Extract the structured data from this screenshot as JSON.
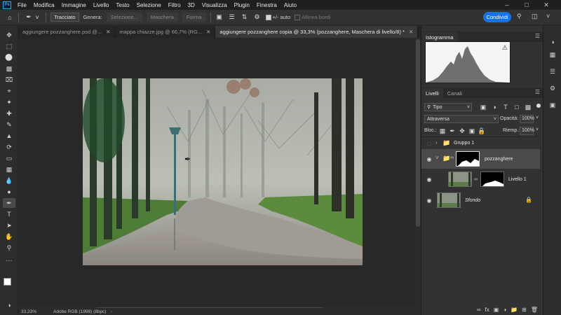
{
  "app": {
    "logo_text": "Ps"
  },
  "menu": [
    "File",
    "Modifica",
    "Immagine",
    "Livello",
    "Testo",
    "Selezione",
    "Filtro",
    "3D",
    "Visualizza",
    "Plugin",
    "Finestra",
    "Aiuto"
  ],
  "options": {
    "mode_value": "Tracciato",
    "generate_label": "Genera:",
    "selection_label": "Selezione...",
    "mask_label": "Maschera",
    "shape_label": "Forma",
    "auto_label": "+/- auto",
    "align_edges_label": "Allinea bordi",
    "share_label": "Condividi"
  },
  "tabs": [
    {
      "label": "aggiungere pozzanghere.psd @..."
    },
    {
      "label": "mappa chiazze.jpg @ 66,7% (RG..."
    },
    {
      "label": "aggiungere pozzanghere copia @ 33,3% (pozzanghere, Maschera di livello/8) *"
    }
  ],
  "status": {
    "zoom": "33,33%",
    "profile": "Adobe RGB (1998) (8bpc)"
  },
  "panels": {
    "histogram_tab": "Istogramma",
    "layers_tab": "Livelli",
    "channels_tab": "Canali",
    "filter_kind": "Tipo",
    "blend_mode": "Attraversa",
    "opacity_label": "Opacità:",
    "opacity_value": "100%",
    "lock_label": "Bloc.:",
    "fill_label": "Riemp.:",
    "fill_value": "100%"
  },
  "layers": [
    {
      "name": "Gruppo 1",
      "kind": "group"
    },
    {
      "name": "pozzanghere",
      "kind": "group-with-mask"
    },
    {
      "name": "Livello 1",
      "kind": "layer-with-mask"
    },
    {
      "name": "Sfondo",
      "kind": "background"
    }
  ],
  "colors": {
    "accent": "#1473e6",
    "panel_bg": "#323232",
    "canvas_bg": "#282828"
  }
}
